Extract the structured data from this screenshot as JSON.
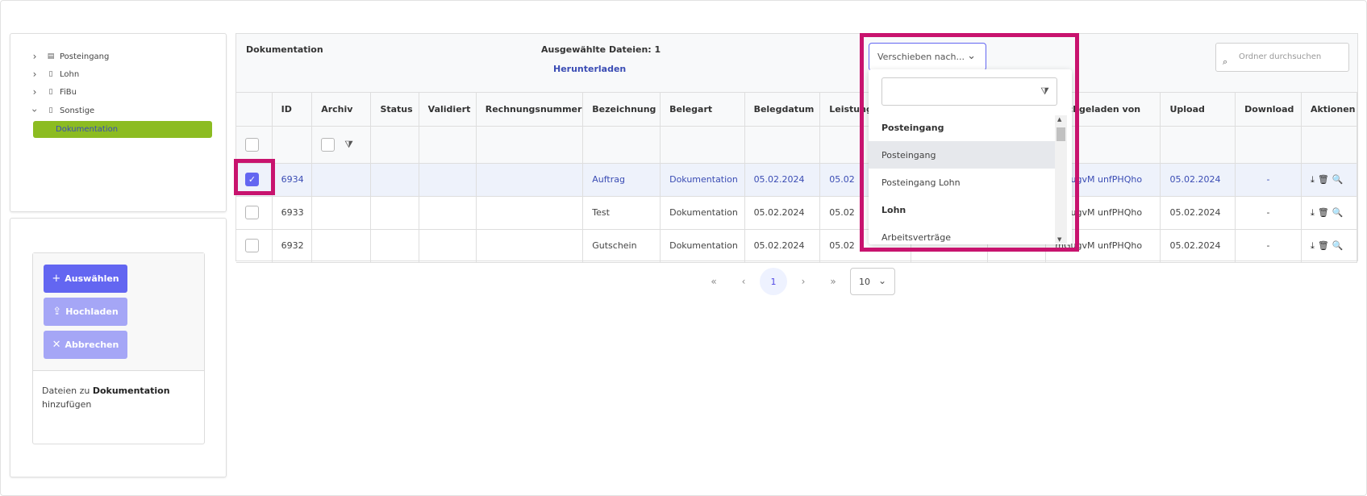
{
  "tree": {
    "items": [
      {
        "label": "Posteingang",
        "icon": "archive-box-icon",
        "expanded": false
      },
      {
        "label": "Lohn",
        "icon": "document-icon",
        "expanded": false
      },
      {
        "label": "FiBu",
        "icon": "document-icon",
        "expanded": false
      },
      {
        "label": "Sonstige",
        "icon": "document-icon",
        "expanded": true
      }
    ],
    "selected_child": "Dokumentation",
    "accent": "#8cbc21"
  },
  "upload": {
    "select_label": "Auswählen",
    "upload_label": "Hochladen",
    "cancel_label": "Abbrechen",
    "hint_prefix": "Dateien zu",
    "hint_target": "Dokumentation",
    "hint_suffix": "hinzufügen"
  },
  "header": {
    "title": "Dokumentation",
    "selected_files": "Ausgewählte Dateien: 1",
    "download_link": "Herunterladen",
    "move_placeholder": "Verschieben nach...",
    "search_placeholder": "Ordner durchsuchen"
  },
  "table": {
    "columns": [
      "",
      "ID",
      "Archiv",
      "Status",
      "Validiert",
      "Rechnungsnummer",
      "Bezeichnung",
      "Belegart",
      "Belegdatum",
      "Leistungs",
      "",
      "",
      "hochgeladen von",
      "Upload",
      "Download",
      "Aktionen"
    ],
    "rows": [
      {
        "checked": true,
        "id": "6934",
        "bezeichnung": "Auftrag",
        "belegart": "Dokumentation",
        "belegdatum": "05.02.2024",
        "leistung": "05.02",
        "uploader": "mGugvM unfPHQho",
        "upload": "05.02.2024",
        "download": "-"
      },
      {
        "checked": false,
        "id": "6933",
        "bezeichnung": "Test",
        "belegart": "Dokumentation",
        "belegdatum": "05.02.2024",
        "leistung": "05.02",
        "uploader": "mGugvM unfPHQho",
        "upload": "05.02.2024",
        "download": "-"
      },
      {
        "checked": false,
        "id": "6932",
        "bezeichnung": "Gutschein",
        "belegart": "Dokumentation",
        "belegdatum": "05.02.2024",
        "leistung": "05.02",
        "uploader": "mGugvM unfPHQho",
        "upload": "05.02.2024",
        "download": "-"
      }
    ]
  },
  "pager": {
    "current_page": "1",
    "page_size": "10"
  },
  "dropdown": {
    "items": [
      {
        "label": "Posteingang",
        "group": true
      },
      {
        "label": "Posteingang",
        "group": false,
        "highlighted": true
      },
      {
        "label": "Posteingang Lohn",
        "group": false
      },
      {
        "label": "Lohn",
        "group": true
      },
      {
        "label": "Arbeitsverträge",
        "group": false
      }
    ]
  },
  "colors": {
    "primary": "#6366f1",
    "primary_disabled": "#a5a6f6",
    "link": "#3a4cb4",
    "annotation": "#c8136e"
  }
}
